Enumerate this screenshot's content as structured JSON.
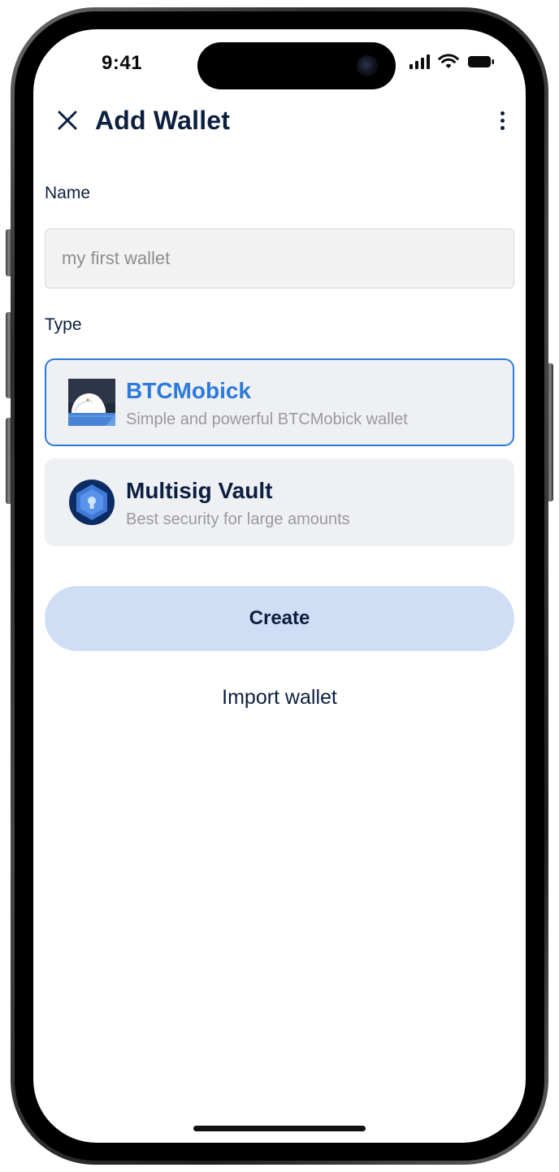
{
  "status_bar": {
    "time": "9:41",
    "signal_icon": "cellular-signal-icon",
    "wifi_icon": "wifi-icon",
    "battery_icon": "battery-icon"
  },
  "header": {
    "title": "Add Wallet",
    "close_icon": "close-icon",
    "more_icon": "more-vertical-icon"
  },
  "form": {
    "name_label": "Name",
    "name_value": "",
    "name_placeholder": "my first wallet",
    "type_label": "Type",
    "wallet_types": [
      {
        "title": "BTCMobick",
        "subtitle": "Simple and powerful BTCMobick wallet",
        "icon": "btcmobick-logo-icon",
        "selected": true
      },
      {
        "title": "Multisig Vault",
        "subtitle": "Best security for large amounts",
        "icon": "vault-shield-icon",
        "selected": false
      }
    ]
  },
  "actions": {
    "create_label": "Create",
    "import_label": "Import wallet"
  },
  "colors": {
    "accent": "#2c7ad9",
    "text_primary": "#0c1f3f",
    "text_secondary": "#9a9a9a",
    "card_background": "#eef0f4",
    "create_button_background": "#cfdef5"
  }
}
